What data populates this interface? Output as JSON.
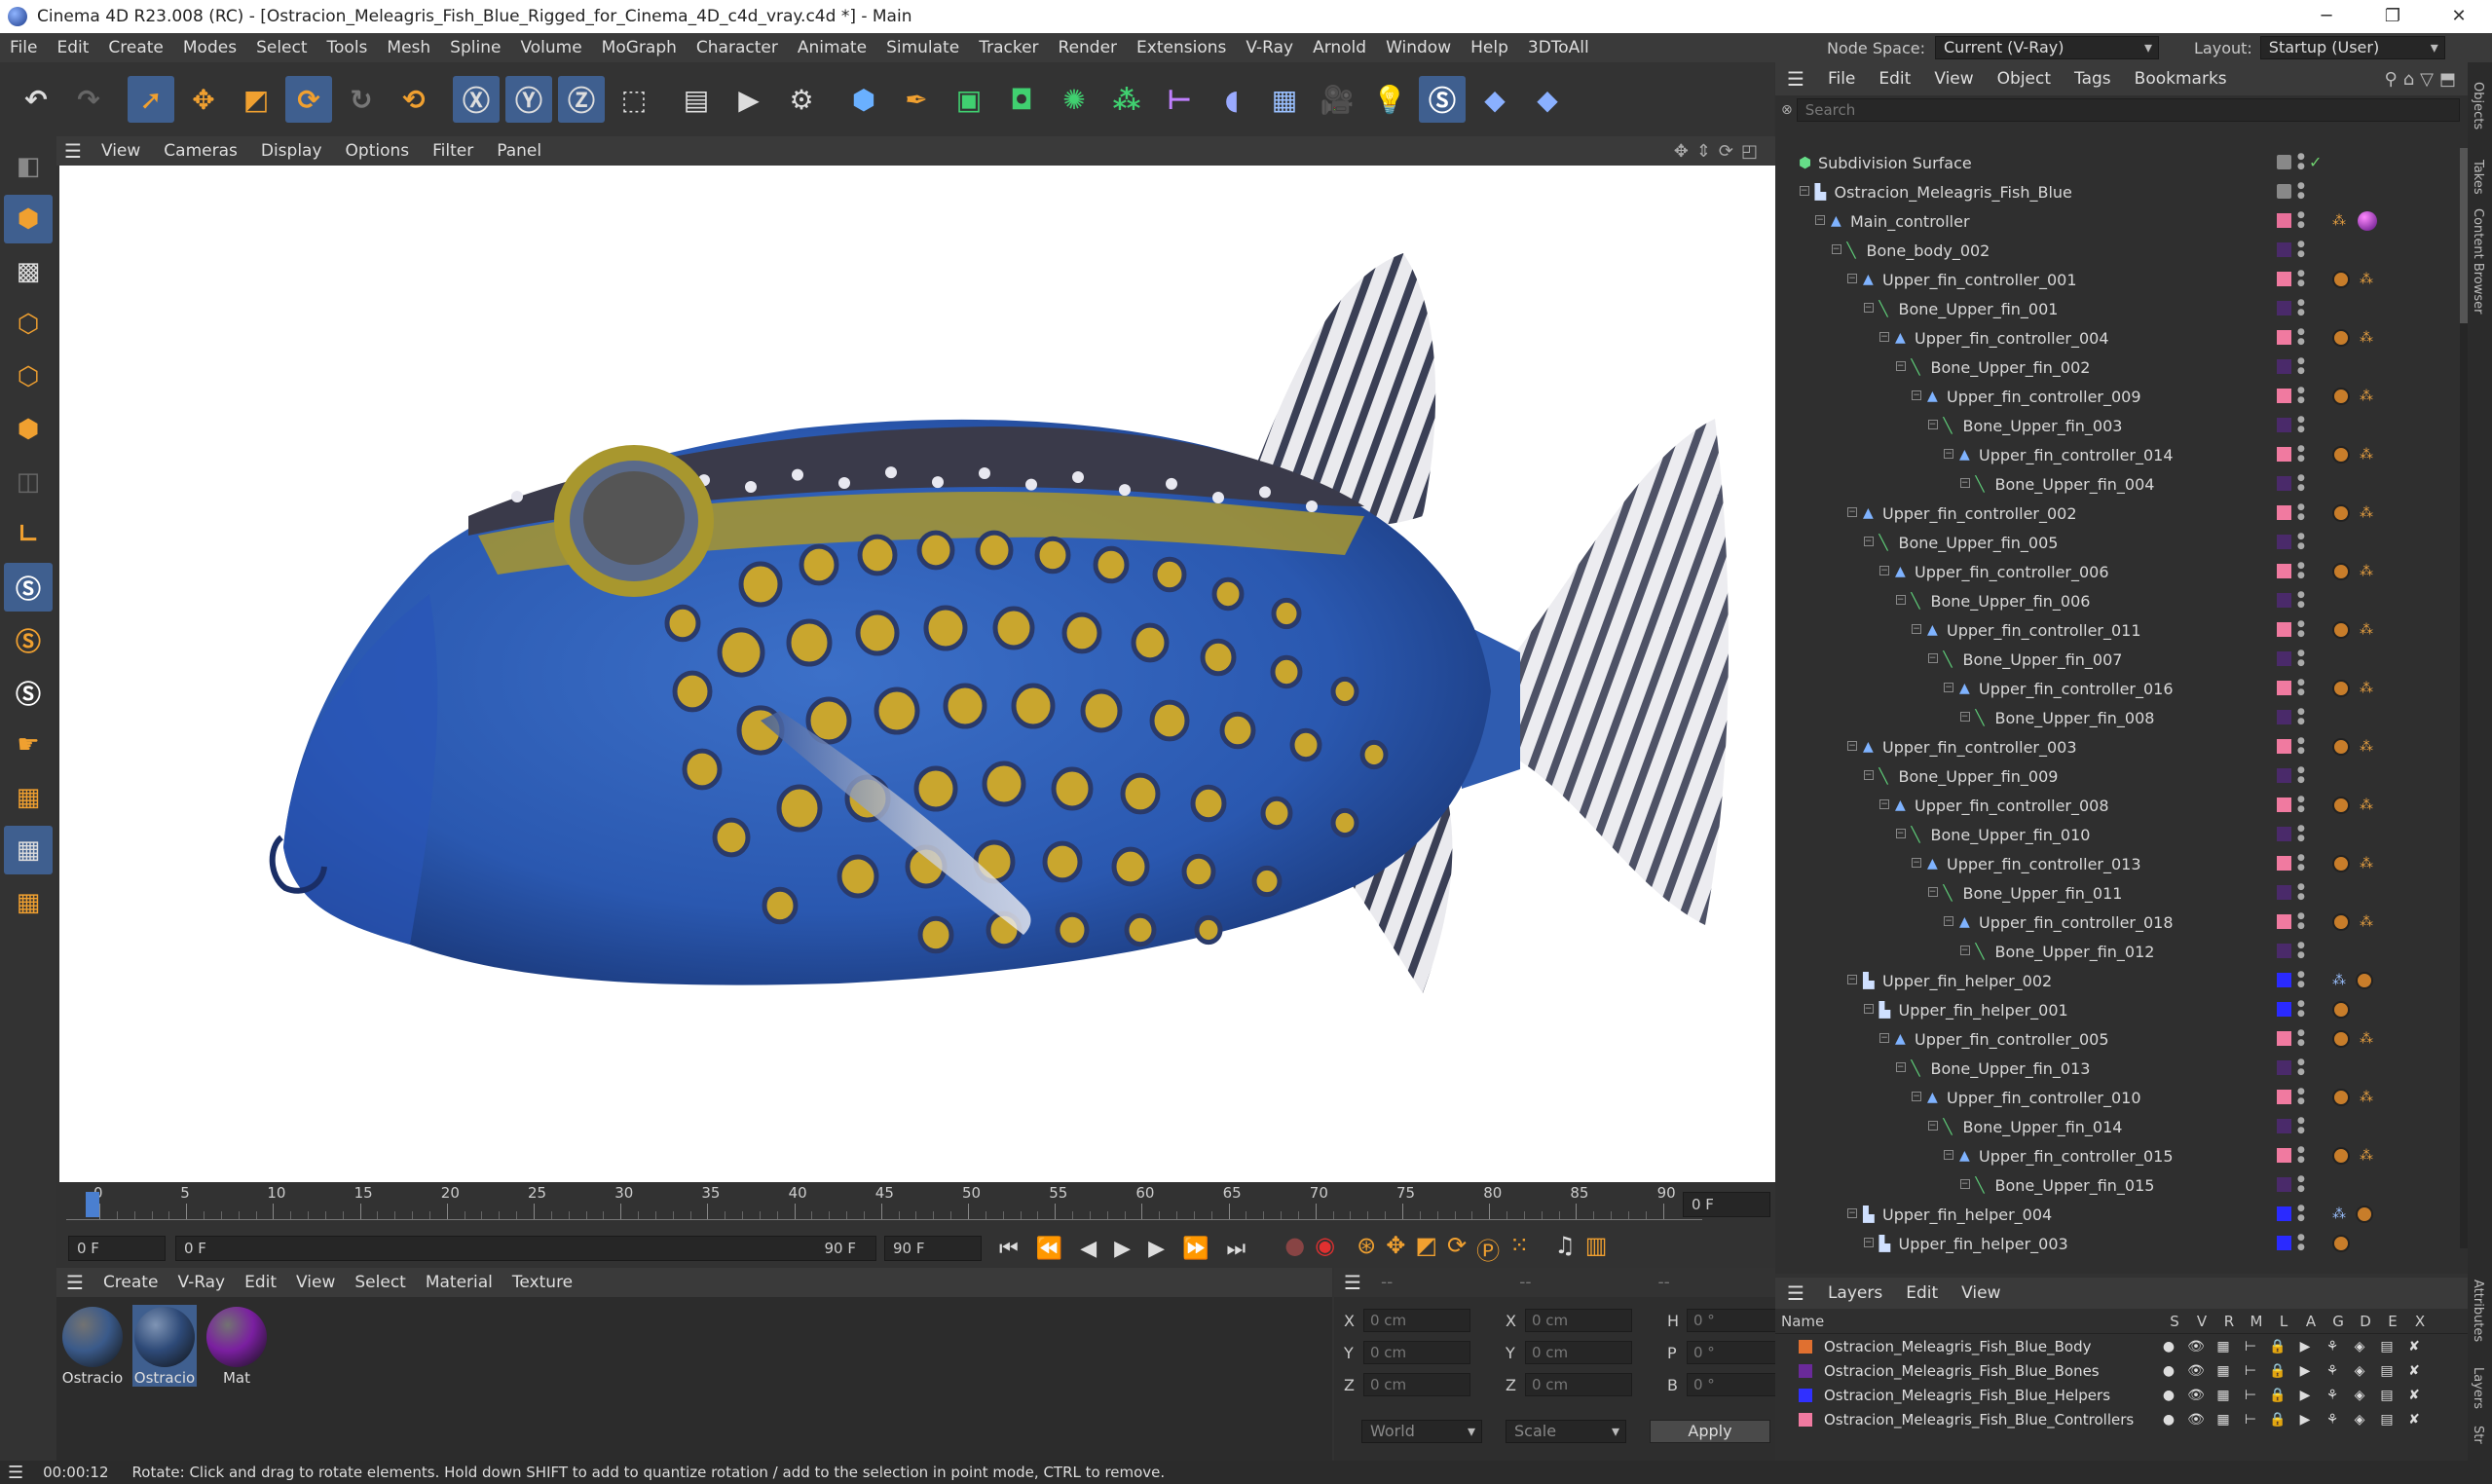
{
  "window": {
    "title": "Cinema 4D R23.008 (RC) - [Ostracion_Meleagris_Fish_Blue_Rigged_for_Cinema_4D_c4d_vray.c4d *] - Main",
    "minimize": "─",
    "maximize": "❐",
    "close": "✕"
  },
  "menu": [
    "File",
    "Edit",
    "Create",
    "Modes",
    "Select",
    "Tools",
    "Mesh",
    "Spline",
    "Volume",
    "MoGraph",
    "Character",
    "Animate",
    "Simulate",
    "Tracker",
    "Render",
    "Extensions",
    "V-Ray",
    "Arnold",
    "Window",
    "Help",
    "3DToAll"
  ],
  "nodespace": {
    "label": "Node Space:",
    "value": "Current (V-Ray)",
    "layout_label": "Layout:",
    "layout_value": "Startup (User)"
  },
  "viewport_menu": [
    "View",
    "Cameras",
    "Display",
    "Options",
    "Filter",
    "Panel"
  ],
  "timeline": {
    "ticks": [
      "0",
      "5",
      "10",
      "15",
      "20",
      "25",
      "30",
      "35",
      "40",
      "45",
      "50",
      "55",
      "60",
      "65",
      "70",
      "75",
      "80",
      "85",
      "90"
    ],
    "current_frame": "0 F",
    "start": "0 F",
    "range_start": "0 F",
    "range_end": "90 F",
    "end": "90 F"
  },
  "material_menu": [
    "Create",
    "V-Ray",
    "Edit",
    "View",
    "Select",
    "Material",
    "Texture"
  ],
  "materials": [
    {
      "label": "Ostracio",
      "color": "#3a5a8a"
    },
    {
      "label": "Ostracio",
      "color": "#2e4a78"
    },
    {
      "label": "Mat",
      "color": "#7a1fa0"
    }
  ],
  "coords": {
    "header": [
      "--",
      "--",
      "--"
    ],
    "rows": [
      {
        "l1": "X",
        "v1": "0 cm",
        "l2": "X",
        "v2": "0 cm",
        "l3": "H",
        "v3": "0 °"
      },
      {
        "l1": "Y",
        "v1": "0 cm",
        "l2": "Y",
        "v2": "0 cm",
        "l3": "P",
        "v3": "0 °"
      },
      {
        "l1": "Z",
        "v1": "0 cm",
        "l2": "Z",
        "v2": "0 cm",
        "l3": "B",
        "v3": "0 °"
      }
    ],
    "mode": "World",
    "scale": "Scale",
    "apply": "Apply"
  },
  "status": {
    "time": "00:00:12",
    "message": "Rotate: Click and drag to rotate elements. Hold down SHIFT to add to quantize rotation / add to the selection in point mode, CTRL to remove."
  },
  "objects_menu": [
    "File",
    "Edit",
    "View",
    "Object",
    "Tags",
    "Bookmarks"
  ],
  "search_placeholder": "Search",
  "tree": [
    {
      "name": "Subdivision Surface",
      "depth": 0,
      "type": "sub",
      "layer": "",
      "tag": "check"
    },
    {
      "name": "Ostracion_Meleagris_Fish_Blue",
      "depth": 1,
      "type": "helper",
      "layer": "",
      "tag": ""
    },
    {
      "name": "Main_controller",
      "depth": 2,
      "type": "null",
      "layer": "#e8709a",
      "tag": "mat"
    },
    {
      "name": "Bone_body_002",
      "depth": 3,
      "type": "bone",
      "layer": "#4a2a6a",
      "tag": ""
    },
    {
      "name": "Upper_fin_controller_001",
      "depth": 4,
      "type": "null",
      "layer": "#f07aa0",
      "tag": "ik"
    },
    {
      "name": "Bone_Upper_fin_001",
      "depth": 5,
      "type": "bone",
      "layer": "#4a2a6a",
      "tag": ""
    },
    {
      "name": "Upper_fin_controller_004",
      "depth": 6,
      "type": "null",
      "layer": "#f07aa0",
      "tag": "ik"
    },
    {
      "name": "Bone_Upper_fin_002",
      "depth": 7,
      "type": "bone",
      "layer": "#4a2a6a",
      "tag": ""
    },
    {
      "name": "Upper_fin_controller_009",
      "depth": 8,
      "type": "null",
      "layer": "#f07aa0",
      "tag": "ik"
    },
    {
      "name": "Bone_Upper_fin_003",
      "depth": 9,
      "type": "bone",
      "layer": "#4a2a6a",
      "tag": ""
    },
    {
      "name": "Upper_fin_controller_014",
      "depth": 10,
      "type": "null",
      "layer": "#f07aa0",
      "tag": "ik"
    },
    {
      "name": "Bone_Upper_fin_004",
      "depth": 11,
      "type": "bone",
      "layer": "#4a2a6a",
      "tag": ""
    },
    {
      "name": "Upper_fin_controller_002",
      "depth": 4,
      "type": "null",
      "layer": "#f07aa0",
      "tag": "ik"
    },
    {
      "name": "Bone_Upper_fin_005",
      "depth": 5,
      "type": "bone",
      "layer": "#4a2a6a",
      "tag": ""
    },
    {
      "name": "Upper_fin_controller_006",
      "depth": 6,
      "type": "null",
      "layer": "#f07aa0",
      "tag": "ik"
    },
    {
      "name": "Bone_Upper_fin_006",
      "depth": 7,
      "type": "bone",
      "layer": "#4a2a6a",
      "tag": ""
    },
    {
      "name": "Upper_fin_controller_011",
      "depth": 8,
      "type": "null",
      "layer": "#f07aa0",
      "tag": "ik"
    },
    {
      "name": "Bone_Upper_fin_007",
      "depth": 9,
      "type": "bone",
      "layer": "#4a2a6a",
      "tag": ""
    },
    {
      "name": "Upper_fin_controller_016",
      "depth": 10,
      "type": "null",
      "layer": "#f07aa0",
      "tag": "ik"
    },
    {
      "name": "Bone_Upper_fin_008",
      "depth": 11,
      "type": "bone",
      "layer": "#4a2a6a",
      "tag": ""
    },
    {
      "name": "Upper_fin_controller_003",
      "depth": 4,
      "type": "null",
      "layer": "#f07aa0",
      "tag": "ik"
    },
    {
      "name": "Bone_Upper_fin_009",
      "depth": 5,
      "type": "bone",
      "layer": "#4a2a6a",
      "tag": ""
    },
    {
      "name": "Upper_fin_controller_008",
      "depth": 6,
      "type": "null",
      "layer": "#f07aa0",
      "tag": "ik"
    },
    {
      "name": "Bone_Upper_fin_010",
      "depth": 7,
      "type": "bone",
      "layer": "#4a2a6a",
      "tag": ""
    },
    {
      "name": "Upper_fin_controller_013",
      "depth": 8,
      "type": "null",
      "layer": "#f07aa0",
      "tag": "ik"
    },
    {
      "name": "Bone_Upper_fin_011",
      "depth": 9,
      "type": "bone",
      "layer": "#4a2a6a",
      "tag": ""
    },
    {
      "name": "Upper_fin_controller_018",
      "depth": 10,
      "type": "null",
      "layer": "#f07aa0",
      "tag": "ik"
    },
    {
      "name": "Bone_Upper_fin_012",
      "depth": 11,
      "type": "bone",
      "layer": "#4a2a6a",
      "tag": ""
    },
    {
      "name": "Upper_fin_helper_002",
      "depth": 4,
      "type": "helper",
      "layer": "#2a2aff",
      "tag": "helper"
    },
    {
      "name": "Upper_fin_helper_001",
      "depth": 5,
      "type": "helper",
      "layer": "#2a2aff",
      "tag": "helper1"
    },
    {
      "name": "Upper_fin_controller_005",
      "depth": 6,
      "type": "null",
      "layer": "#f07aa0",
      "tag": "ik"
    },
    {
      "name": "Bone_Upper_fin_013",
      "depth": 7,
      "type": "bone",
      "layer": "#4a2a6a",
      "tag": ""
    },
    {
      "name": "Upper_fin_controller_010",
      "depth": 8,
      "type": "null",
      "layer": "#f07aa0",
      "tag": "ik"
    },
    {
      "name": "Bone_Upper_fin_014",
      "depth": 9,
      "type": "bone",
      "layer": "#4a2a6a",
      "tag": ""
    },
    {
      "name": "Upper_fin_controller_015",
      "depth": 10,
      "type": "null",
      "layer": "#f07aa0",
      "tag": "ik"
    },
    {
      "name": "Bone_Upper_fin_015",
      "depth": 11,
      "type": "bone",
      "layer": "#4a2a6a",
      "tag": ""
    },
    {
      "name": "Upper_fin_helper_004",
      "depth": 4,
      "type": "helper",
      "layer": "#2a2aff",
      "tag": "helper"
    },
    {
      "name": "Upper_fin_helper_003",
      "depth": 5,
      "type": "helper",
      "layer": "#2a2aff",
      "tag": "helper1"
    }
  ],
  "layers_menu": [
    "Layers",
    "Edit",
    "View"
  ],
  "layers_header": {
    "name": "Name",
    "cols": [
      "S",
      "V",
      "R",
      "M",
      "L",
      "A",
      "G",
      "D",
      "E",
      "X"
    ]
  },
  "layers": [
    {
      "name": "Ostracion_Meleagris_Fish_Blue_Body",
      "color": "#e07030"
    },
    {
      "name": "Ostracion_Meleagris_Fish_Blue_Bones",
      "color": "#6a2a9a"
    },
    {
      "name": "Ostracion_Meleagris_Fish_Blue_Helpers",
      "color": "#3030ff"
    },
    {
      "name": "Ostracion_Meleagris_Fish_Blue_Controllers",
      "color": "#f07aa0"
    }
  ],
  "side_tabs": [
    "Objects",
    "Takes",
    "Content Browser",
    "Attributes",
    "Layers",
    "Str"
  ]
}
